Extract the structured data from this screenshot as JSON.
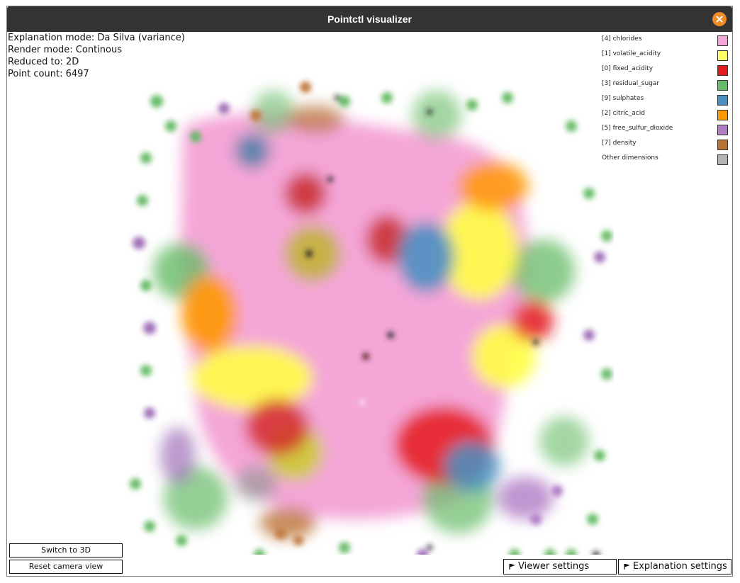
{
  "window": {
    "title": "Pointctl visualizer"
  },
  "info": {
    "explanation_mode": "Explanation mode: Da Silva (variance)",
    "render_mode": "Render mode: Continous",
    "reduced_to": "Reduced to: 2D",
    "point_count": "Point count: 6497"
  },
  "legend": [
    {
      "label": "[4] chlorides",
      "color": "#f4a6d7"
    },
    {
      "label": "[1] volatile_acidity",
      "color": "#ffff66"
    },
    {
      "label": "[0] fixed_acidity",
      "color": "#e41a1c"
    },
    {
      "label": "[3] residual_sugar",
      "color": "#66bb66"
    },
    {
      "label": "[9] sulphates",
      "color": "#4a90c2"
    },
    {
      "label": "[2] citric_acid",
      "color": "#ff9900"
    },
    {
      "label": "[5] free_sulfur_dioxide",
      "color": "#b07cc6"
    },
    {
      "label": "[7] density",
      "color": "#b87333"
    },
    {
      "label": "Other dimensions",
      "color": "#b3b3b3"
    }
  ],
  "buttons": {
    "switch_3d": "Switch to 3D",
    "reset_camera": "Reset camera view"
  },
  "expanders": {
    "viewer_settings": "Viewer settings",
    "explanation_settings": "Explanation settings"
  },
  "icons": {
    "close": "close-icon",
    "expander": "expander-flag-icon"
  },
  "accent_color": "#f08a24"
}
